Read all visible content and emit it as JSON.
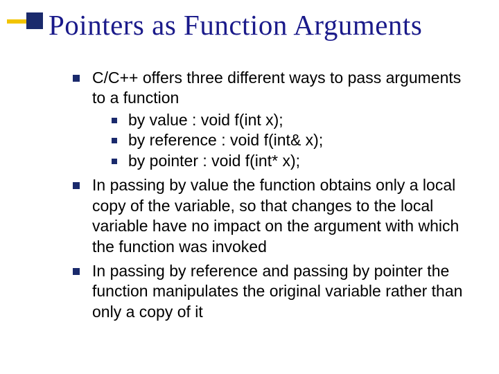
{
  "title": "Pointers as Function Arguments",
  "bullets": [
    {
      "text": "C/C++ offers three different ways to pass arguments to a function",
      "sub": [
        "by value  :  void f(int x);",
        "by reference : void f(int& x);",
        "by pointer : void f(int* x);"
      ]
    },
    {
      "text": "In passing by value the function obtains only a local copy of the variable, so that changes to the local variable have no impact on the argument with which the function was invoked",
      "sub": []
    },
    {
      "text": "In passing by reference and passing by pointer the function manipulates the original variable rather than only a copy of it",
      "sub": []
    }
  ]
}
